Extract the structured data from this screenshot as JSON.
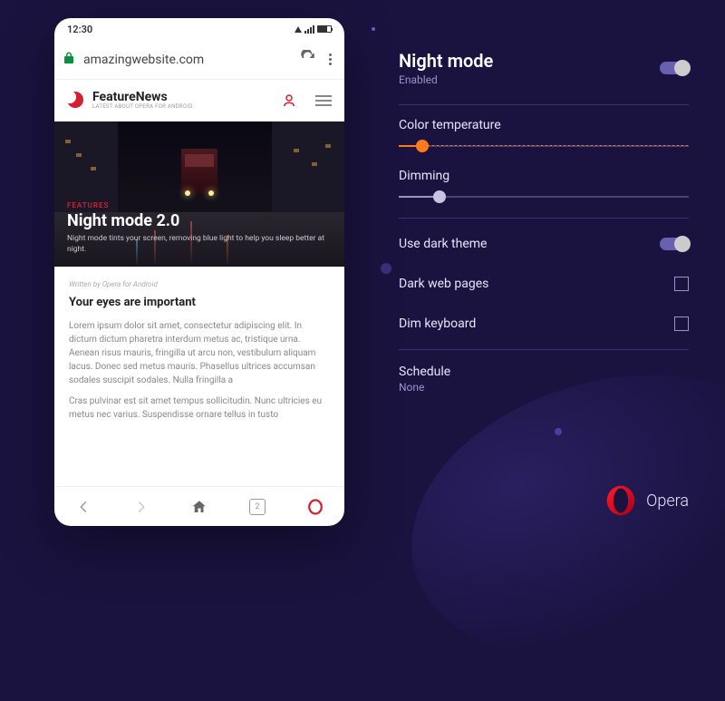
{
  "status": {
    "time": "12:30"
  },
  "browser": {
    "url": "amazingwebsite.com",
    "tabs_count": "2"
  },
  "site": {
    "logo_name": "FeatureNews",
    "logo_sub": "LATEST ABOUT OPERA FOR ANDROID"
  },
  "hero": {
    "tag": "FEATURES",
    "title": "Night mode 2.0",
    "desc": "Night mode tints your screen, removing blue light to help you sleep better at night."
  },
  "article": {
    "byline": "Written by Opera for Android",
    "heading": "Your eyes are important",
    "p1": "Lorem ipsum dolor sit amet, consectetur adipiscing elit. In dictum dictum pharetra interdum metus ac, tristique urna. Aenean risus mauris, fringilla ut arcu non, vestibulum aliquam lacus. Donec sed metus mauris. Phasellus ultrices accumsan sodales suscipit sodales. Nulla fringilla a",
    "p2": "Cras pulvinar est sit amet tempus sollicitudin. Nunc ultricies eu metus nec varius. Suspendisse ornare tellus in tusto"
  },
  "settings": {
    "title": "Night mode",
    "status": "Enabled",
    "night_mode_on": true,
    "color_temp_label": "Color temperature",
    "color_temp_pct": 8,
    "dimming_label": "Dimming",
    "dimming_pct": 14,
    "dark_theme_label": "Use dark theme",
    "dark_theme_on": true,
    "dark_pages_label": "Dark web pages",
    "dim_keyboard_label": "Dim keyboard",
    "schedule_label": "Schedule",
    "schedule_value": "None"
  },
  "brand": {
    "name": "Opera"
  }
}
